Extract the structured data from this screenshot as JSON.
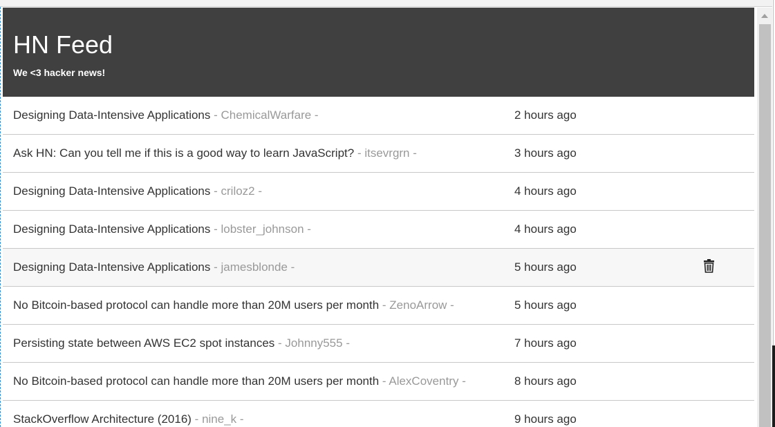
{
  "header": {
    "title": "HN Feed",
    "subtitle": "We <3 hacker news!"
  },
  "stories": [
    {
      "title": "Designing Data-Intensive Applications",
      "author": "ChemicalWarfare",
      "time": "2 hours ago"
    },
    {
      "title": "Ask HN: Can you tell me if this is a good way to learn JavaScript?",
      "author": "itsevrgrn",
      "time": "3 hours ago"
    },
    {
      "title": "Designing Data-Intensive Applications",
      "author": "criloz2",
      "time": "4 hours ago"
    },
    {
      "title": "Designing Data-Intensive Applications",
      "author": "lobster_johnson",
      "time": "4 hours ago"
    },
    {
      "title": "Designing Data-Intensive Applications",
      "author": "jamesblonde",
      "time": "5 hours ago",
      "hovered": true
    },
    {
      "title": "No Bitcoin-based protocol can handle more than 20M users per month",
      "author": "ZenoArrow",
      "time": "5 hours ago"
    },
    {
      "title": "Persisting state between AWS EC2 spot instances",
      "author": "Johnny555",
      "time": "7 hours ago"
    },
    {
      "title": "No Bitcoin-based protocol can handle more than 20M users per month",
      "author": "AlexCoventry",
      "time": "8 hours ago"
    },
    {
      "title": "StackOverflow Architecture (2016)",
      "author": "nine_k",
      "time": "9 hours ago"
    }
  ],
  "author_separator": " - ",
  "row_action_icon": "trash-icon",
  "colors": {
    "header_bg": "#404040",
    "author_text": "#999999",
    "hover_row_bg": "#f7f7f7"
  }
}
